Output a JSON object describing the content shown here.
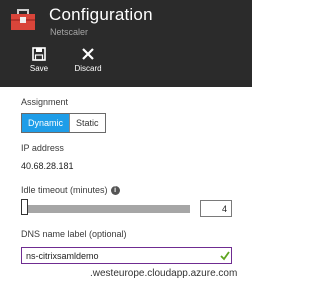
{
  "header": {
    "title": "Configuration",
    "subtitle": "Netscaler",
    "icon": "toolbox-icon",
    "background": "#2b2b2b"
  },
  "toolbar": {
    "save_label": "Save",
    "discard_label": "Discard"
  },
  "assignment": {
    "label": "Assignment",
    "options": [
      "Dynamic",
      "Static"
    ],
    "selected": "Dynamic",
    "accent": "#1e9de8"
  },
  "ip": {
    "label": "IP address",
    "value": "40.68.28.181"
  },
  "idle_timeout": {
    "label": "Idle timeout (minutes)",
    "value": "4",
    "info_icon": "info-icon"
  },
  "dns": {
    "label": "DNS name label (optional)",
    "value": "ns-citrixsamldemo",
    "suffix": ".westeurope.cloudapp.azure.com",
    "valid_color": "#5ea520"
  }
}
